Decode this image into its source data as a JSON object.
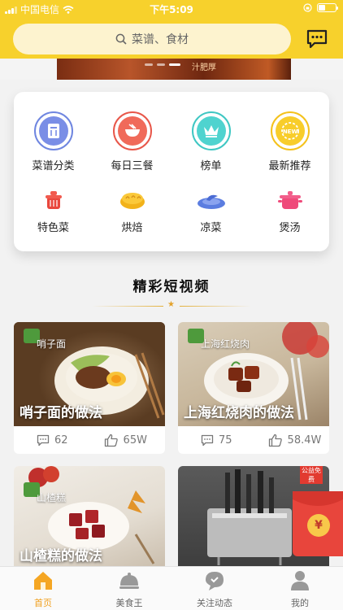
{
  "status_bar": {
    "carrier": "中国电信",
    "time": "下午5:09"
  },
  "search": {
    "placeholder": "菜谱、食材"
  },
  "banner": {
    "tag": "汁肥厚"
  },
  "categories": [
    {
      "label": "菜谱分类",
      "icon": "recipe-book-icon"
    },
    {
      "label": "每日三餐",
      "icon": "bowl-icon"
    },
    {
      "label": "榜单",
      "icon": "crown-icon"
    },
    {
      "label": "最新推荐",
      "icon": "new-badge-icon"
    },
    {
      "label": "特色菜",
      "icon": "hotpot-icon"
    },
    {
      "label": "烘焙",
      "icon": "bread-icon"
    },
    {
      "label": "凉菜",
      "icon": "plate-icon"
    },
    {
      "label": "煲汤",
      "icon": "soup-pot-icon"
    }
  ],
  "section": {
    "title": "精彩短视频"
  },
  "videos": [
    {
      "title": "哨子面的做法",
      "tag": "哨子面",
      "comments": "62",
      "likes": "65W"
    },
    {
      "title": "上海红烧肉的做法",
      "tag": "上海红烧肉",
      "comments": "75",
      "likes": "58.4W"
    },
    {
      "title": "山楂糕的做法",
      "tag": "山楂糕"
    },
    {
      "title": "",
      "tag": "公益免费"
    }
  ],
  "tabs": [
    {
      "label": "首页",
      "icon": "home-icon",
      "active": true
    },
    {
      "label": "美食王",
      "icon": "cloche-icon",
      "active": false
    },
    {
      "label": "关注动态",
      "icon": "chat-bubble-icon",
      "active": false
    },
    {
      "label": "我的",
      "icon": "person-icon",
      "active": false
    }
  ],
  "red_packet": {
    "symbol": "¥"
  },
  "colors": {
    "accent": "#f7d12c",
    "active_tab": "#f0a020"
  }
}
